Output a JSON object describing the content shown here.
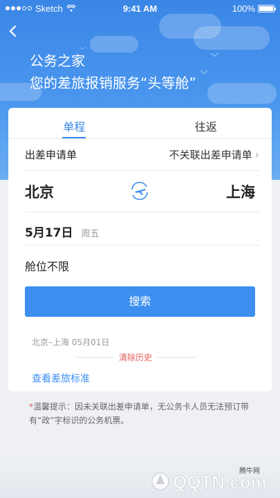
{
  "status_bar": {
    "carrier": "Sketch",
    "time": "9:41 AM",
    "battery": "100%"
  },
  "header": {
    "line1": "公务之家",
    "line2": "您的差旅报销服务“头等舱”"
  },
  "tabs": [
    {
      "label": "单程",
      "active": true
    },
    {
      "label": "往返",
      "active": false
    }
  ],
  "apply": {
    "label": "出差申请单",
    "value": "不关联出差申请单"
  },
  "route": {
    "from": "北京",
    "to": "上海"
  },
  "date": {
    "value": "5月17日",
    "weekday": "周五"
  },
  "cabin": "舱位不限",
  "search_button": "搜索",
  "history": {
    "items": [
      "北京–上海 05月01日"
    ],
    "clear_label": "清除历史"
  },
  "standard_link": "查看差旅标准",
  "tip": {
    "star": "*",
    "text": "温馨提示：因未关联出差申请单，无公务卡人员无法预订带有“政”字标识的公务机票。"
  },
  "watermark": {
    "text": "QQTN.com",
    "cn": "腾牛网"
  },
  "colors": {
    "primary": "#3d8ff0",
    "accent_red": "#e35b5b",
    "header_bg": "#3a86e6"
  }
}
